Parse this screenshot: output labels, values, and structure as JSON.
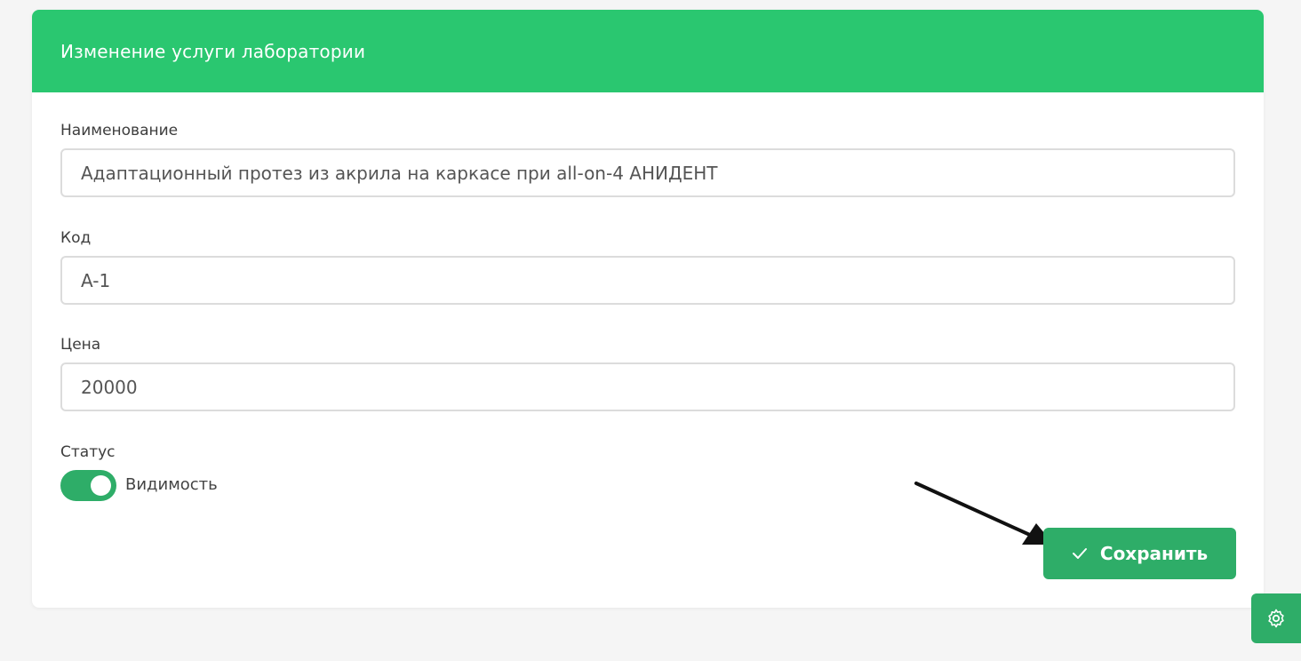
{
  "header": {
    "title": "Изменение услуги лаборатории"
  },
  "form": {
    "name": {
      "label": "Наименование",
      "value": "Адаптационный протез из акрила на каркасе при all-on-4 АНИДЕНТ"
    },
    "code": {
      "label": "Код",
      "value": "A-1"
    },
    "price": {
      "label": "Цена",
      "value": "20000"
    },
    "status": {
      "label": "Статус",
      "toggle_label": "Видимость",
      "enabled": true
    }
  },
  "actions": {
    "save_label": "Сохранить",
    "save_icon": "check-icon"
  },
  "floating": {
    "settings_icon": "gear-icon"
  },
  "colors": {
    "header_green": "#2ac770",
    "button_green": "#2ead68"
  }
}
